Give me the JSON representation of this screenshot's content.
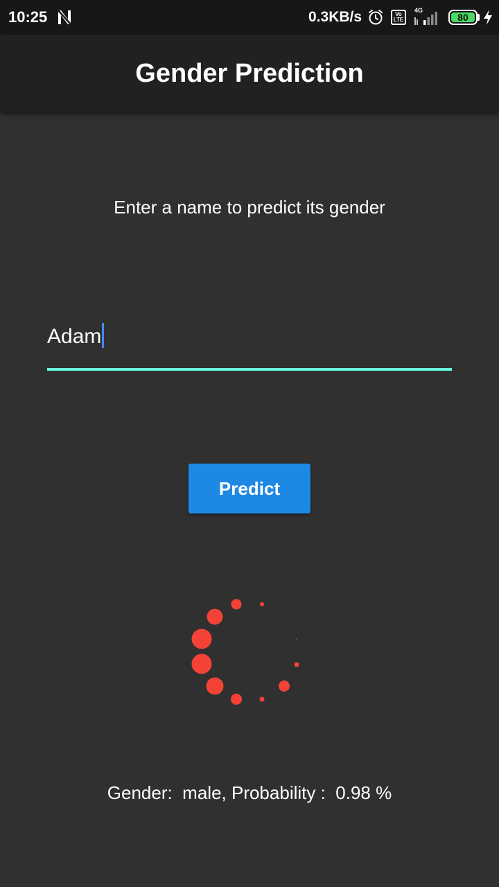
{
  "status_bar": {
    "time": "10:25",
    "network_speed": "0.3KB/s",
    "volte_label": "Vo LTE",
    "network_type": "4G",
    "battery_level": "80",
    "icons": [
      "n-notification-icon",
      "alarm-icon",
      "volte-icon",
      "signal-icon",
      "battery-icon",
      "charging-bolt-icon"
    ]
  },
  "app_bar": {
    "title": "Gender Prediction"
  },
  "main": {
    "instruction": "Enter a name to predict its gender",
    "name_input": {
      "value": "Adam"
    },
    "predict_button_label": "Predict",
    "loading_indicator": "spinner-icon",
    "result_text": "Gender:  male, Probability :  0.98 %"
  },
  "colors": {
    "background": "#303030",
    "app_bar": "#212121",
    "status_bar": "#171717",
    "accent_underline": "#64ffda",
    "button": "#1e88e5",
    "cursor": "#448aff",
    "spinner": "#f44336",
    "battery": "#4cd964"
  }
}
